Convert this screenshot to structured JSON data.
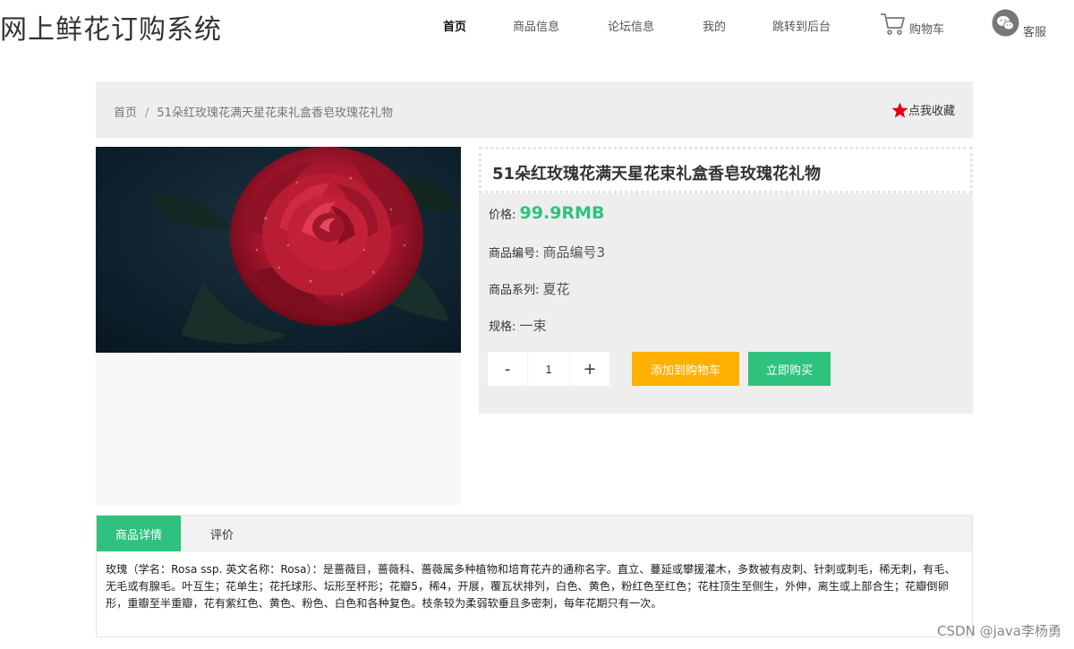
{
  "header": {
    "site_title": "网上鲜花订购系统",
    "nav": [
      {
        "label": "首页",
        "active": true
      },
      {
        "label": "商品信息"
      },
      {
        "label": "论坛信息"
      },
      {
        "label": "我的"
      },
      {
        "label": "跳转到后台"
      }
    ],
    "cart_label": "购物车",
    "service_label": "客服"
  },
  "breadcrumb": {
    "home": "首页",
    "separator": "/",
    "current": "51朵红玫瑰花满天星花束礼盒香皂玫瑰花礼物"
  },
  "favorite_label": "点我收藏",
  "product": {
    "title": "51朵红玫瑰花满天星花束礼盒香皂玫瑰花礼物",
    "image_icon": "red-rose-photo",
    "price_label": "价格:",
    "price": "99.9RMB",
    "code_label": "商品编号:",
    "code": "商品编号3",
    "series_label": "商品系列:",
    "series": "夏花",
    "spec_label": "规格:",
    "spec": "一束",
    "qty_minus": "-",
    "qty_value": "1",
    "qty_plus": "+",
    "add_cart": "添加到购物车",
    "buy_now": "立即购买"
  },
  "tabs": {
    "detail": "商品详情",
    "review": "评价",
    "description": "玫瑰（学名：Rosa ssp. 英文名称：Rosa）：是蔷薇目，蔷薇科、蔷薇属多种植物和培育花卉的通称名字。直立、蔓延或攀援灌木，多数被有皮刺、针刺或刺毛，稀无刺，有毛、无毛或有腺毛。叶互生；花单生；花托球形、坛形至杯形；花瓣5，稀4，开展，覆瓦状排列，白色、黄色，粉红色至红色；花柱顶生至侧生，外伸，离生或上部合生；花瓣倒卵形，重瓣至半重瓣，花有紫红色、黄色、粉色、白色和各种复色。枝条较为柔弱软垂且多密刺，每年花期只有一次。"
  },
  "watermark": "CSDN @java李杨勇",
  "colors": {
    "accent": "#2ec27e",
    "cart_button": "#ffb000",
    "favorite_star": "#e60012"
  }
}
